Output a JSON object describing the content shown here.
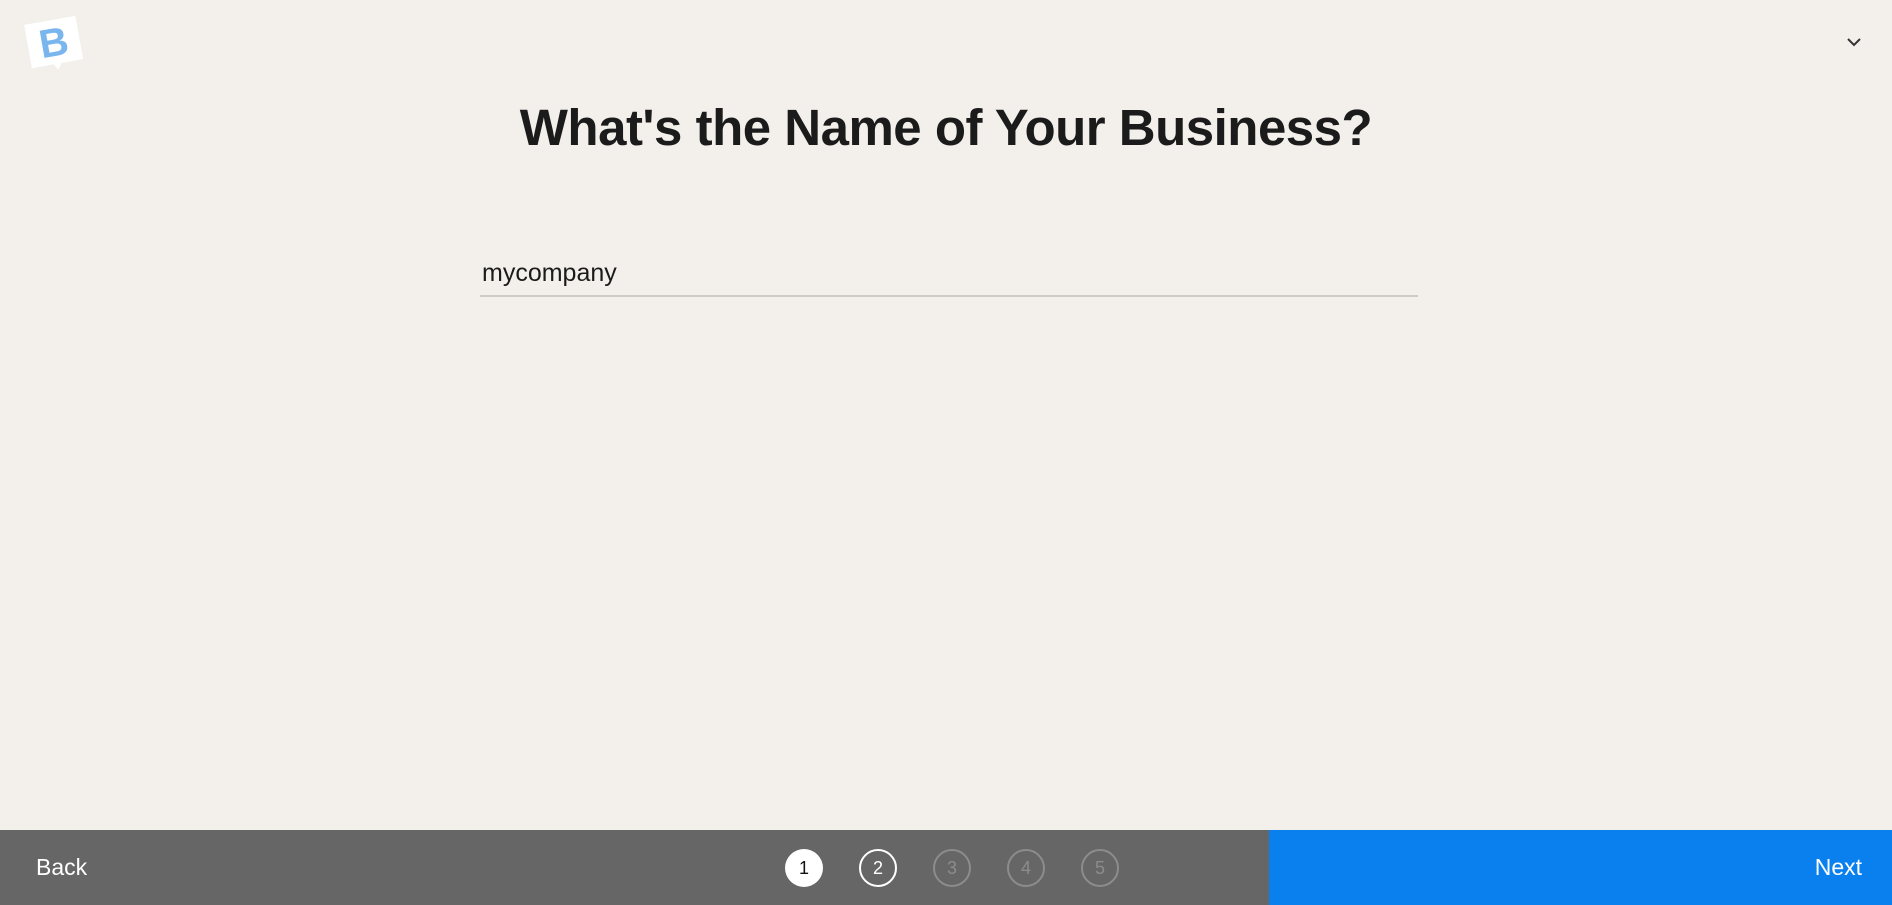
{
  "header": {
    "logo_icon": "b-logo-icon",
    "logo_color": "#79b6ee",
    "menu_icon": "chevron-down-icon"
  },
  "title": "What's the Name of Your Business?",
  "business_name": {
    "value": "mycompany",
    "placeholder": ""
  },
  "footer": {
    "back_label": "Back",
    "next_label": "Next",
    "next_color": "#0a80ef",
    "steps": [
      {
        "label": "1",
        "state": "active"
      },
      {
        "label": "2",
        "state": "done"
      },
      {
        "label": "3",
        "state": "pending"
      },
      {
        "label": "4",
        "state": "pending"
      },
      {
        "label": "5",
        "state": "pending"
      }
    ]
  }
}
